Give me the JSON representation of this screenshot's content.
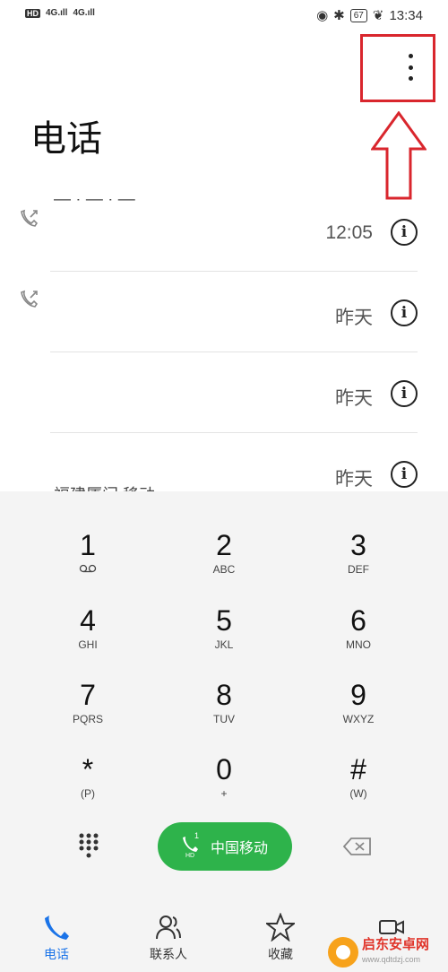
{
  "status_bar": {
    "hd_badge": "HD",
    "signal1": "4G.ıll",
    "signal2": "4G.ıll",
    "battery": "67",
    "time": "13:34"
  },
  "header": {
    "title": "电话",
    "more_menu_icon": "more-vertical-icon"
  },
  "call_log": [
    {
      "time": "12:05",
      "type_icon": "outgoing-call-icon",
      "info_icon": "info-icon"
    },
    {
      "time": "昨天",
      "type_icon": "outgoing-call-icon",
      "info_icon": "info-icon"
    },
    {
      "time": "昨天",
      "type_icon": "",
      "info_icon": "info-icon"
    },
    {
      "time": "昨天",
      "location": "福建厦门 移动",
      "info_icon": "info-icon"
    }
  ],
  "keypad": {
    "keys": [
      {
        "digit": "1",
        "letters": ""
      },
      {
        "digit": "2",
        "letters": "ABC"
      },
      {
        "digit": "3",
        "letters": "DEF"
      },
      {
        "digit": "4",
        "letters": "GHI"
      },
      {
        "digit": "5",
        "letters": "JKL"
      },
      {
        "digit": "6",
        "letters": "MNO"
      },
      {
        "digit": "7",
        "letters": "PQRS"
      },
      {
        "digit": "8",
        "letters": "TUV"
      },
      {
        "digit": "9",
        "letters": "WXYZ"
      },
      {
        "digit": "*",
        "letters": "(P)"
      },
      {
        "digit": "0",
        "letters": "+"
      },
      {
        "digit": "#",
        "letters": "(W)"
      }
    ],
    "call_label": "中国移动",
    "call_sim": "1",
    "call_hd": "HD"
  },
  "bottom_nav": {
    "items": [
      {
        "label": "电话",
        "icon": "phone-icon"
      },
      {
        "label": "联系人",
        "icon": "contacts-icon"
      },
      {
        "label": "收藏",
        "icon": "star-icon"
      },
      {
        "label": "",
        "icon": "video-icon"
      }
    ]
  },
  "watermark": {
    "title": "启东安卓网",
    "url": "www.qdtdzj.com"
  },
  "colors": {
    "call_green": "#2eb34b",
    "accent_blue": "#1a73e8",
    "highlight_red": "#d9262d"
  }
}
